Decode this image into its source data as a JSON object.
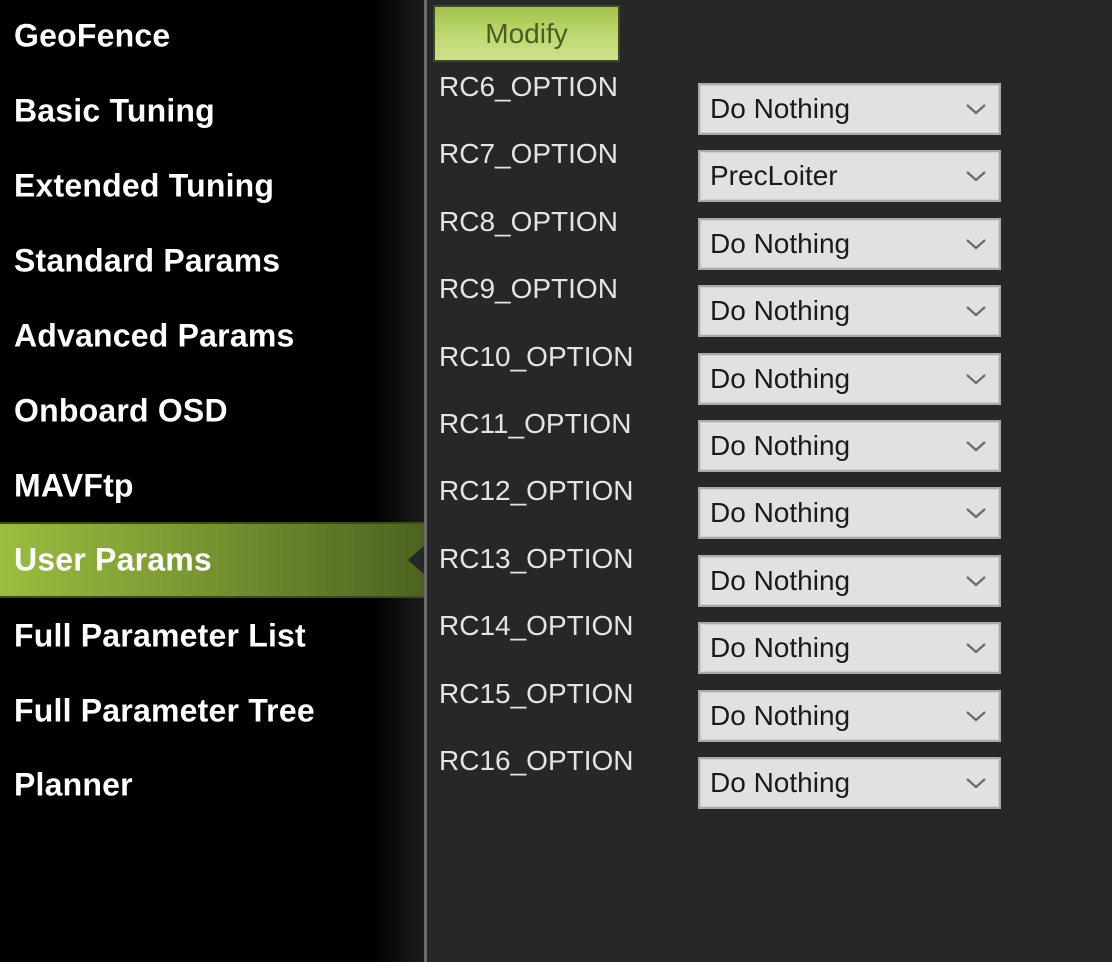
{
  "sidebar": {
    "items": [
      {
        "label": "GeoFence"
      },
      {
        "label": "Basic Tuning"
      },
      {
        "label": "Extended Tuning"
      },
      {
        "label": "Standard Params"
      },
      {
        "label": "Advanced Params"
      },
      {
        "label": "Onboard OSD"
      },
      {
        "label": "MAVFtp"
      },
      {
        "label": "User Params",
        "active": true
      },
      {
        "label": "Full Parameter List"
      },
      {
        "label": "Full Parameter Tree"
      },
      {
        "label": "Planner"
      }
    ]
  },
  "main": {
    "modify_label": "Modify",
    "params": [
      {
        "name": "RC6_OPTION",
        "value": "Do Nothing"
      },
      {
        "name": "RC7_OPTION",
        "value": "PrecLoiter"
      },
      {
        "name": "RC8_OPTION",
        "value": "Do Nothing"
      },
      {
        "name": "RC9_OPTION",
        "value": "Do Nothing"
      },
      {
        "name": "RC10_OPTION",
        "value": "Do Nothing"
      },
      {
        "name": "RC11_OPTION",
        "value": "Do Nothing"
      },
      {
        "name": "RC12_OPTION",
        "value": "Do Nothing"
      },
      {
        "name": "RC13_OPTION",
        "value": "Do Nothing"
      },
      {
        "name": "RC14_OPTION",
        "value": "Do Nothing"
      },
      {
        "name": "RC15_OPTION",
        "value": "Do Nothing"
      },
      {
        "name": "RC16_OPTION",
        "value": "Do Nothing"
      }
    ]
  },
  "colors": {
    "accent": "#8aab38",
    "panel_bg": "#262729",
    "sidebar_bg": "#000000"
  }
}
